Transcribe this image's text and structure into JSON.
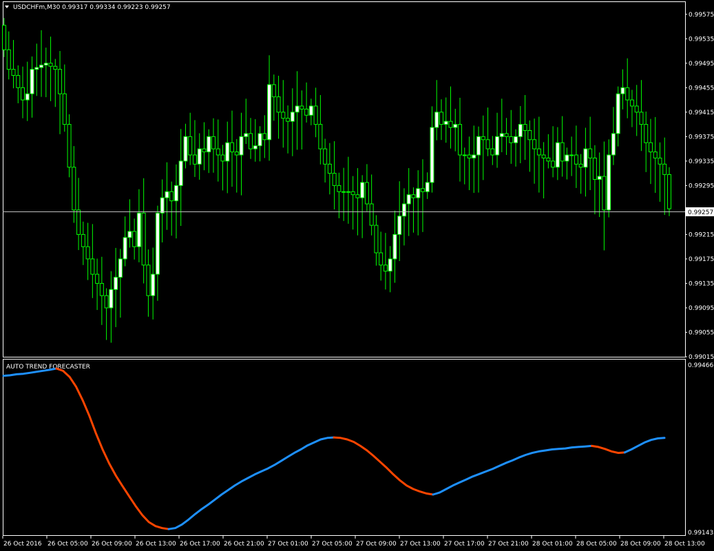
{
  "main_panel": {
    "title": "USDCHFm,M30  0.99317 0.99334 0.99223 0.99257",
    "menu_icon": "triangle-down-icon",
    "price_labels": [
      "0.99575",
      "0.99535",
      "0.99495",
      "0.99455",
      "0.99415",
      "0.99375",
      "0.99335",
      "0.99295",
      "0.99257",
      "0.99215",
      "0.99175",
      "0.99135",
      "0.99095",
      "0.99055",
      "0.99015"
    ],
    "current_price": "0.99257"
  },
  "indicator_panel": {
    "title": "AUTO TREND FORECASTER",
    "top_label": "0.994666",
    "bottom_label": "0.991435"
  },
  "time_labels": [
    "26 Oct 2016",
    "26 Oct 05:00",
    "26 Oct 09:00",
    "26 Oct 13:00",
    "26 Oct 17:00",
    "26 Oct 21:00",
    "27 Oct 01:00",
    "27 Oct 05:00",
    "27 Oct 09:00",
    "27 Oct 13:00",
    "27 Oct 17:00",
    "27 Oct 21:00",
    "28 Oct 01:00",
    "28 Oct 05:00",
    "28 Oct 09:00",
    "28 Oct 13:00"
  ],
  "colors": {
    "background": "#000000",
    "axis": "#ffffff",
    "bull_candle": "#ffffff",
    "wick": "#00ff00",
    "bear_candle": "#000000",
    "trend_up": "#1e90ff",
    "trend_down": "#ff4500"
  },
  "chart_data": [
    {
      "type": "candlestick",
      "symbol": "USDCHFm",
      "timeframe": "M30",
      "ylim": [
        0.99015,
        0.99595
      ],
      "x_start": "26 Oct 2016 01:00",
      "close_values": [
        0.99517,
        0.99485,
        0.99475,
        0.99455,
        0.99435,
        0.99445,
        0.99485,
        0.99488,
        0.99492,
        0.99495,
        0.9949,
        0.99485,
        0.99445,
        0.99395,
        0.99325,
        0.99255,
        0.99215,
        0.99195,
        0.99175,
        0.9915,
        0.99135,
        0.99115,
        0.99095,
        0.99125,
        0.99145,
        0.99175,
        0.9921,
        0.9922,
        0.99195,
        0.9925,
        0.99165,
        0.99115,
        0.9915,
        0.9925,
        0.99275,
        0.99285,
        0.9927,
        0.99295,
        0.99335,
        0.99375,
        0.99345,
        0.9933,
        0.99355,
        0.9935,
        0.99375,
        0.99355,
        0.99345,
        0.99335,
        0.99365,
        0.9935,
        0.99345,
        0.99375,
        0.9938,
        0.99355,
        0.9936,
        0.9938,
        0.9937,
        0.9946,
        0.9944,
        0.99415,
        0.99405,
        0.994,
        0.99415,
        0.99425,
        0.9942,
        0.9941,
        0.99425,
        0.99395,
        0.99355,
        0.9933,
        0.99315,
        0.99295,
        0.99285,
        0.99285,
        0.99285,
        0.9928,
        0.99275,
        0.993,
        0.99265,
        0.9923,
        0.99185,
        0.99165,
        0.99155,
        0.99175,
        0.99215,
        0.99245,
        0.99265,
        0.9928,
        0.99275,
        0.9929,
        0.99285,
        0.993,
        0.9939,
        0.99415,
        0.99395,
        0.994,
        0.9939,
        0.99395,
        0.99345,
        0.99345,
        0.9934,
        0.99345,
        0.99375,
        0.9937,
        0.99355,
        0.99345,
        0.99375,
        0.9938,
        0.99375,
        0.99365,
        0.99375,
        0.99395,
        0.99385,
        0.9937,
        0.99355,
        0.99345,
        0.9934,
        0.99335,
        0.99325,
        0.99365,
        0.99335,
        0.99345,
        0.99345,
        0.9933,
        0.99325,
        0.99355,
        0.9934,
        0.99305,
        0.9931,
        0.99255,
        0.99345,
        0.9938,
        0.99445,
        0.99455,
        0.99435,
        0.99425,
        0.99415,
        0.99395,
        0.99365,
        0.9935,
        0.9934,
        0.9933,
        0.99313,
        0.99257
      ]
    },
    {
      "type": "line",
      "name": "AUTO TREND FORECASTER",
      "ylim": [
        0.991435,
        0.994666
      ],
      "segments": [
        {
          "direction": "up",
          "values": [
            0.99452,
            0.99453,
            0.99455,
            0.99456,
            0.99458,
            0.9946,
            0.99462,
            0.99464,
            0.994666
          ]
        },
        {
          "direction": "down",
          "values": [
            0.994666,
            0.99462,
            0.9945,
            0.9943,
            0.99403,
            0.99372,
            0.99337,
            0.99305,
            0.99277,
            0.99253,
            0.99232,
            0.99212,
            0.99192,
            0.99174,
            0.9916,
            0.99152,
            0.99148,
            0.99146
          ]
        },
        {
          "direction": "up",
          "values": [
            0.99146,
            0.99148,
            0.99155,
            0.99165,
            0.99176,
            0.99186,
            0.99195,
            0.99205,
            0.99215,
            0.99224,
            0.99233,
            0.99241,
            0.99248,
            0.99255,
            0.99261,
            0.99267,
            0.99274,
            0.99282,
            0.9929,
            0.99298,
            0.99305,
            0.99313,
            0.99319,
            0.99325,
            0.99328,
            0.99329
          ]
        },
        {
          "direction": "down",
          "values": [
            0.99329,
            0.99328,
            0.99325,
            0.9932,
            0.99312,
            0.99303,
            0.99292,
            0.9928,
            0.99268,
            0.99255,
            0.99243,
            0.99233,
            0.99226,
            0.99221,
            0.99217,
            0.99215
          ]
        },
        {
          "direction": "up",
          "values": [
            0.99215,
            0.99219,
            0.99226,
            0.99233,
            0.99239,
            0.99245,
            0.99251,
            0.99256,
            0.99261,
            0.99266,
            0.99272,
            0.99278,
            0.99283,
            0.99289,
            0.99294,
            0.99298,
            0.99301,
            0.99303,
            0.99305,
            0.99306,
            0.99307,
            0.99309,
            0.9931,
            0.99311,
            0.99312
          ]
        },
        {
          "direction": "down",
          "values": [
            0.99312,
            0.9931,
            0.99306,
            0.99301,
            0.99298,
            0.99299
          ]
        },
        {
          "direction": "up",
          "values": [
            0.99299,
            0.99305,
            0.99312,
            0.99319,
            0.99324,
            0.99327,
            0.99328
          ]
        }
      ]
    }
  ]
}
